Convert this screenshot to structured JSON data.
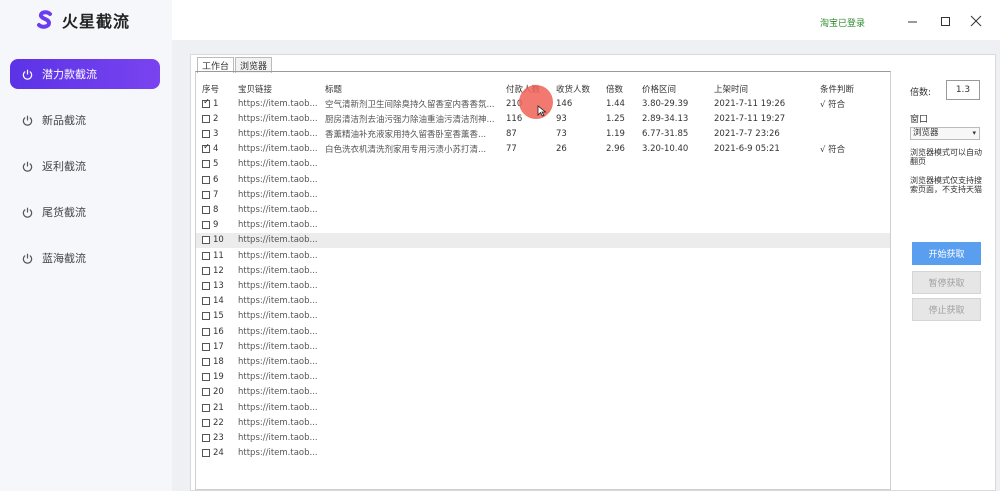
{
  "app": {
    "name": "火星截流",
    "logo_color": "#6a3df0"
  },
  "sidebar": {
    "items": [
      {
        "label": "潜力款截流",
        "active": true
      },
      {
        "label": "新品截流",
        "active": false
      },
      {
        "label": "返利截流",
        "active": false
      },
      {
        "label": "尾货截流",
        "active": false
      },
      {
        "label": "蓝海截流",
        "active": false
      }
    ]
  },
  "titlebar": {
    "login_status": "淘宝已登录"
  },
  "tabs": [
    {
      "label": "工作台"
    },
    {
      "label": "浏览器"
    }
  ],
  "table": {
    "headers": {
      "seq": "序号",
      "link": "宝贝链接",
      "title": "标题",
      "pay": "付款人数",
      "buy": "收货人数",
      "mul": "倍数",
      "price": "价格区间",
      "time": "上架时间",
      "cond": "条件判断"
    },
    "rows": [
      {
        "seq": "1",
        "checked": true,
        "link": "https://item.taob...",
        "title": "空气清新剂卫生间除臭持久留香室内香香氛...",
        "pay": "210",
        "buy": "146",
        "mul": "1.44",
        "price": "3.80-29.39",
        "time": "2021-7-11 19:26",
        "cond": "√ 符合"
      },
      {
        "seq": "2",
        "checked": false,
        "link": "https://item.taob...",
        "title": "厨房清洁剂去油污强力除油重油污清洁剂神...",
        "pay": "116",
        "buy": "93",
        "mul": "1.25",
        "price": "2.89-34.13",
        "time": "2021-7-11 19:27",
        "cond": ""
      },
      {
        "seq": "3",
        "checked": false,
        "link": "https://item.taob...",
        "title": "香薰精油补充液家用持久留香卧室香薰香...",
        "pay": "87",
        "buy": "73",
        "mul": "1.19",
        "price": "6.77-31.85",
        "time": "2021-7-7 23:26",
        "cond": ""
      },
      {
        "seq": "4",
        "checked": true,
        "link": "https://item.taob...",
        "title": "白色洗衣机清洗剂家用专用污渍小苏打清...",
        "pay": "77",
        "buy": "26",
        "mul": "2.96",
        "price": "3.20-10.40",
        "time": "2021-6-9 05:21",
        "cond": "√ 符合"
      },
      {
        "seq": "5",
        "checked": false,
        "link": "https://item.taob...",
        "title": "",
        "pay": "",
        "buy": "",
        "mul": "",
        "price": "",
        "time": "",
        "cond": ""
      },
      {
        "seq": "6",
        "checked": false,
        "link": "https://item.taob...",
        "title": "",
        "pay": "",
        "buy": "",
        "mul": "",
        "price": "",
        "time": "",
        "cond": ""
      },
      {
        "seq": "7",
        "checked": false,
        "link": "https://item.taob...",
        "title": "",
        "pay": "",
        "buy": "",
        "mul": "",
        "price": "",
        "time": "",
        "cond": ""
      },
      {
        "seq": "8",
        "checked": false,
        "link": "https://item.taob...",
        "title": "",
        "pay": "",
        "buy": "",
        "mul": "",
        "price": "",
        "time": "",
        "cond": ""
      },
      {
        "seq": "9",
        "checked": false,
        "link": "https://item.taob...",
        "title": "",
        "pay": "",
        "buy": "",
        "mul": "",
        "price": "",
        "time": "",
        "cond": ""
      },
      {
        "seq": "10",
        "checked": false,
        "selected": true,
        "link": "https://item.taob...",
        "title": "",
        "pay": "",
        "buy": "",
        "mul": "",
        "price": "",
        "time": "",
        "cond": ""
      },
      {
        "seq": "11",
        "checked": false,
        "link": "https://item.taob...",
        "title": "",
        "pay": "",
        "buy": "",
        "mul": "",
        "price": "",
        "time": "",
        "cond": ""
      },
      {
        "seq": "12",
        "checked": false,
        "link": "https://item.taob...",
        "title": "",
        "pay": "",
        "buy": "",
        "mul": "",
        "price": "",
        "time": "",
        "cond": ""
      },
      {
        "seq": "13",
        "checked": false,
        "link": "https://item.taob...",
        "title": "",
        "pay": "",
        "buy": "",
        "mul": "",
        "price": "",
        "time": "",
        "cond": ""
      },
      {
        "seq": "14",
        "checked": false,
        "link": "https://item.taob...",
        "title": "",
        "pay": "",
        "buy": "",
        "mul": "",
        "price": "",
        "time": "",
        "cond": ""
      },
      {
        "seq": "15",
        "checked": false,
        "link": "https://item.taob...",
        "title": "",
        "pay": "",
        "buy": "",
        "mul": "",
        "price": "",
        "time": "",
        "cond": ""
      },
      {
        "seq": "16",
        "checked": false,
        "link": "https://item.taob...",
        "title": "",
        "pay": "",
        "buy": "",
        "mul": "",
        "price": "",
        "time": "",
        "cond": ""
      },
      {
        "seq": "17",
        "checked": false,
        "link": "https://item.taob...",
        "title": "",
        "pay": "",
        "buy": "",
        "mul": "",
        "price": "",
        "time": "",
        "cond": ""
      },
      {
        "seq": "18",
        "checked": false,
        "link": "https://item.taob...",
        "title": "",
        "pay": "",
        "buy": "",
        "mul": "",
        "price": "",
        "time": "",
        "cond": ""
      },
      {
        "seq": "19",
        "checked": false,
        "link": "https://item.taob...",
        "title": "",
        "pay": "",
        "buy": "",
        "mul": "",
        "price": "",
        "time": "",
        "cond": ""
      },
      {
        "seq": "20",
        "checked": false,
        "link": "https://item.taob...",
        "title": "",
        "pay": "",
        "buy": "",
        "mul": "",
        "price": "",
        "time": "",
        "cond": ""
      },
      {
        "seq": "21",
        "checked": false,
        "link": "https://item.taob...",
        "title": "",
        "pay": "",
        "buy": "",
        "mul": "",
        "price": "",
        "time": "",
        "cond": ""
      },
      {
        "seq": "22",
        "checked": false,
        "link": "https://item.taob...",
        "title": "",
        "pay": "",
        "buy": "",
        "mul": "",
        "price": "",
        "time": "",
        "cond": ""
      },
      {
        "seq": "23",
        "checked": false,
        "link": "https://item.taob...",
        "title": "",
        "pay": "",
        "buy": "",
        "mul": "",
        "price": "",
        "time": "",
        "cond": ""
      },
      {
        "seq": "24",
        "checked": false,
        "link": "https://item.taob...",
        "title": "",
        "pay": "",
        "buy": "",
        "mul": "",
        "price": "",
        "time": "",
        "cond": ""
      }
    ]
  },
  "controls": {
    "multiple_label": "倍数:",
    "multiple_value": "1.3",
    "window_label": "窗口",
    "window_select": "浏览器",
    "note1": "浏览器模式可以自动翻页",
    "note2": "浏览器模式仅支持搜索页面，不支持天猫",
    "start_button": "开始获取",
    "pause_button": "暂停获取",
    "stop_button": "停止获取"
  },
  "colors": {
    "accent": "#6a3df0",
    "primary_button": "#5a9ef0",
    "status_green": "#2e8b2e",
    "click_marker": "#ef6156"
  }
}
